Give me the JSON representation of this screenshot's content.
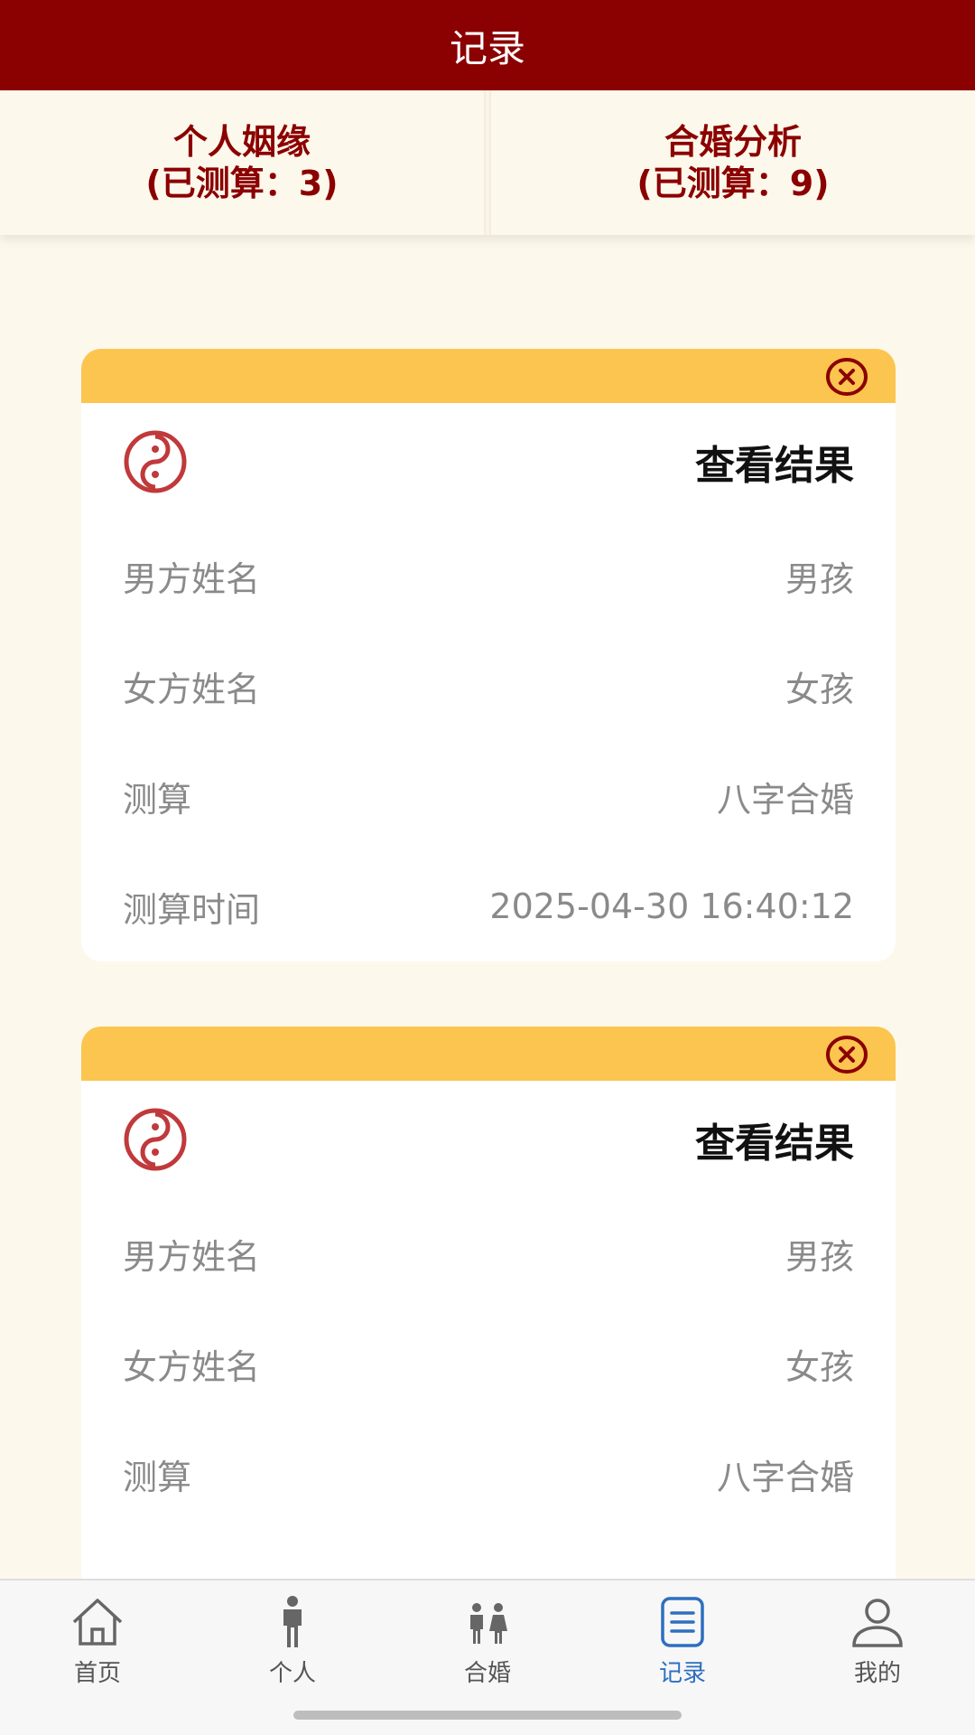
{
  "header": {
    "title": "记录"
  },
  "tabs": [
    {
      "label": "个人姻缘",
      "count": "(已测算：3)"
    },
    {
      "label": "合婚分析",
      "count": "(已测算：9)"
    }
  ],
  "records": [
    {
      "action": "查看结果",
      "rows": [
        {
          "label": "男方姓名",
          "value": "男孩"
        },
        {
          "label": "女方姓名",
          "value": "女孩"
        },
        {
          "label": "测算",
          "value": "八字合婚"
        },
        {
          "label": "测算时间",
          "value": "2025-04-30 16:40:12"
        }
      ]
    },
    {
      "action": "查看结果",
      "rows": [
        {
          "label": "男方姓名",
          "value": "男孩"
        },
        {
          "label": "女方姓名",
          "value": "女孩"
        },
        {
          "label": "测算",
          "value": "八字合婚"
        }
      ]
    }
  ],
  "tabbar": {
    "items": [
      {
        "label": "首页",
        "icon": "home-icon"
      },
      {
        "label": "个人",
        "icon": "person-icon"
      },
      {
        "label": "合婚",
        "icon": "couple-icon"
      },
      {
        "label": "记录",
        "icon": "record-icon"
      },
      {
        "label": "我的",
        "icon": "user-icon"
      }
    ],
    "active": "记录"
  },
  "colors": {
    "header": "#8b0000",
    "card_top": "#fbc54f",
    "background": "#fdf8ec",
    "active_tab": "#2d6fc0"
  }
}
